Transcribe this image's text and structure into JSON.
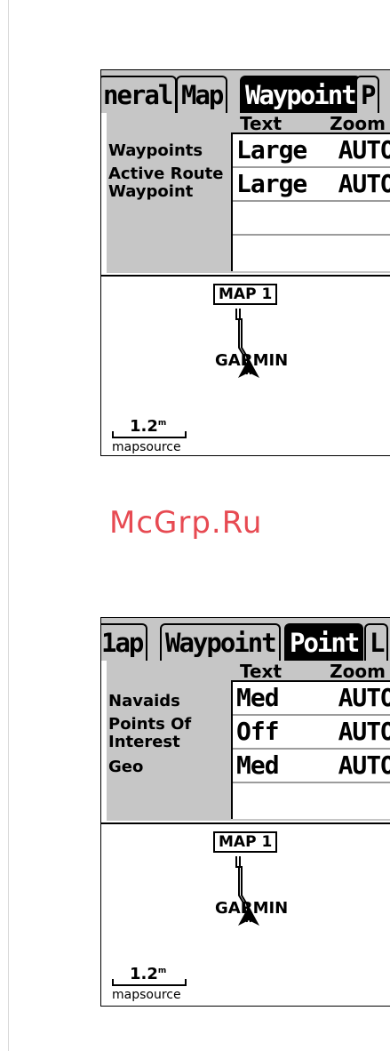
{
  "watermark": "McGrp.Ru",
  "screen1": {
    "tabs": [
      {
        "label": "neral",
        "active": false
      },
      {
        "label": "Map",
        "active": false
      },
      {
        "label": "Waypoint",
        "active": true
      },
      {
        "label": "P",
        "active": false
      }
    ],
    "headers": {
      "text": "Text",
      "zoom": "Zoom"
    },
    "rows": [
      {
        "label": "Waypoints",
        "text": "Large",
        "zoom": "AUTO"
      },
      {
        "label": "Active Route Waypoint",
        "text": "Large",
        "zoom": "AUTO"
      }
    ],
    "map": {
      "label": "MAP 1",
      "marker": "GARMIN",
      "scale": "1.2",
      "scale_unit": "m",
      "source": "mapsource"
    }
  },
  "screen2": {
    "tabs": [
      {
        "label": "1ap",
        "active": false
      },
      {
        "label": "Waypoint",
        "active": false
      },
      {
        "label": "Point",
        "active": true
      },
      {
        "label": "L",
        "active": false
      }
    ],
    "headers": {
      "text": "Text",
      "zoom": "Zoom"
    },
    "rows": [
      {
        "label": "Navaids",
        "text": "Med",
        "zoom": "AUTO"
      },
      {
        "label": "Points Of Interest",
        "text": "Off",
        "zoom": "AUTO"
      },
      {
        "label": "Geo",
        "text": "Med",
        "zoom": "AUTO"
      }
    ],
    "map": {
      "label": "MAP 1",
      "marker": "GARMIN",
      "scale": "1.2",
      "scale_unit": "m",
      "source": "mapsource"
    }
  }
}
